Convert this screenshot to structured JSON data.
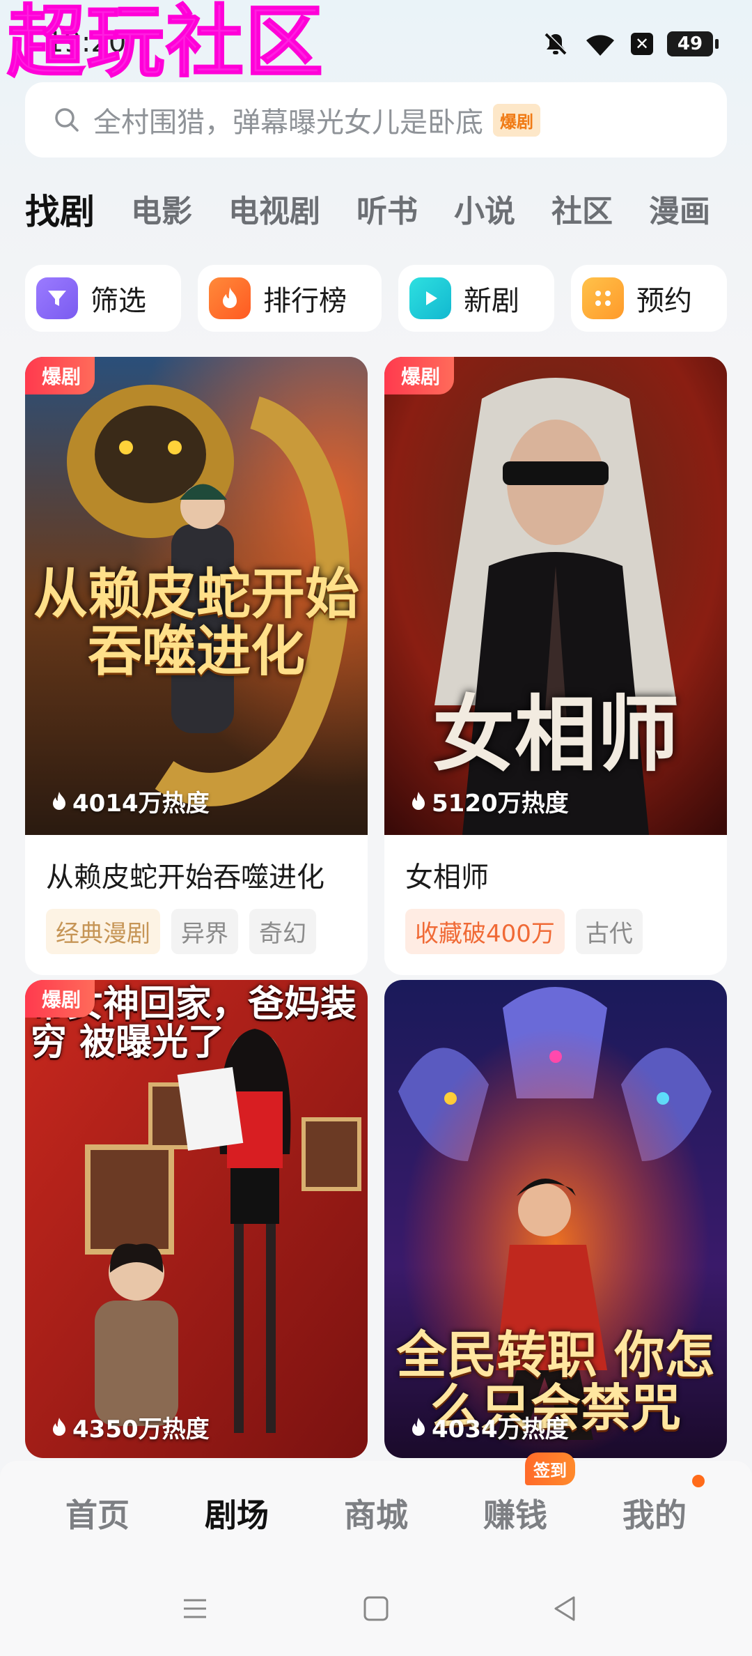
{
  "watermark": "超玩社区",
  "status": {
    "time": "19:20",
    "battery": "49"
  },
  "search": {
    "placeholder": "全村围猎，弹幕曝光女儿是卧底",
    "badge": "爆剧"
  },
  "tabs": [
    "找剧",
    "电影",
    "电视剧",
    "听书",
    "小说",
    "社区",
    "漫画"
  ],
  "quick": [
    {
      "label": "筛选",
      "icon": "filter-icon",
      "color": "#8b6cf0"
    },
    {
      "label": "排行榜",
      "icon": "fire-icon",
      "color": "#ff6a2a"
    },
    {
      "label": "新剧",
      "icon": "play-icon",
      "color": "#1ccfd6"
    },
    {
      "label": "预约",
      "icon": "grid-icon",
      "color": "#ffae3a"
    }
  ],
  "cards": [
    {
      "badge": "爆剧",
      "heat": "4014万热度",
      "cover_text": "从赖皮蛇开始吞噬进化",
      "title": "从赖皮蛇开始吞噬进化",
      "tags": [
        "经典漫剧",
        "异界",
        "奇幻"
      ]
    },
    {
      "badge": "爆剧",
      "heat": "5120万热度",
      "cover_text": "女相师",
      "title": "女相师",
      "tags": [
        "收藏破400万",
        "古代"
      ]
    },
    {
      "badge": "爆剧",
      "heat": "4350万热度",
      "cover_text": "带女神回家，爸妈装穷 被曝光了"
    },
    {
      "badge": "",
      "heat": "4034万热度",
      "cover_text": "全民转职 你怎么只会禁咒"
    }
  ],
  "bottom_nav": {
    "items": [
      "首页",
      "剧场",
      "商城",
      "赚钱",
      "我的"
    ],
    "active": "剧场",
    "sign_badge": "签到"
  }
}
